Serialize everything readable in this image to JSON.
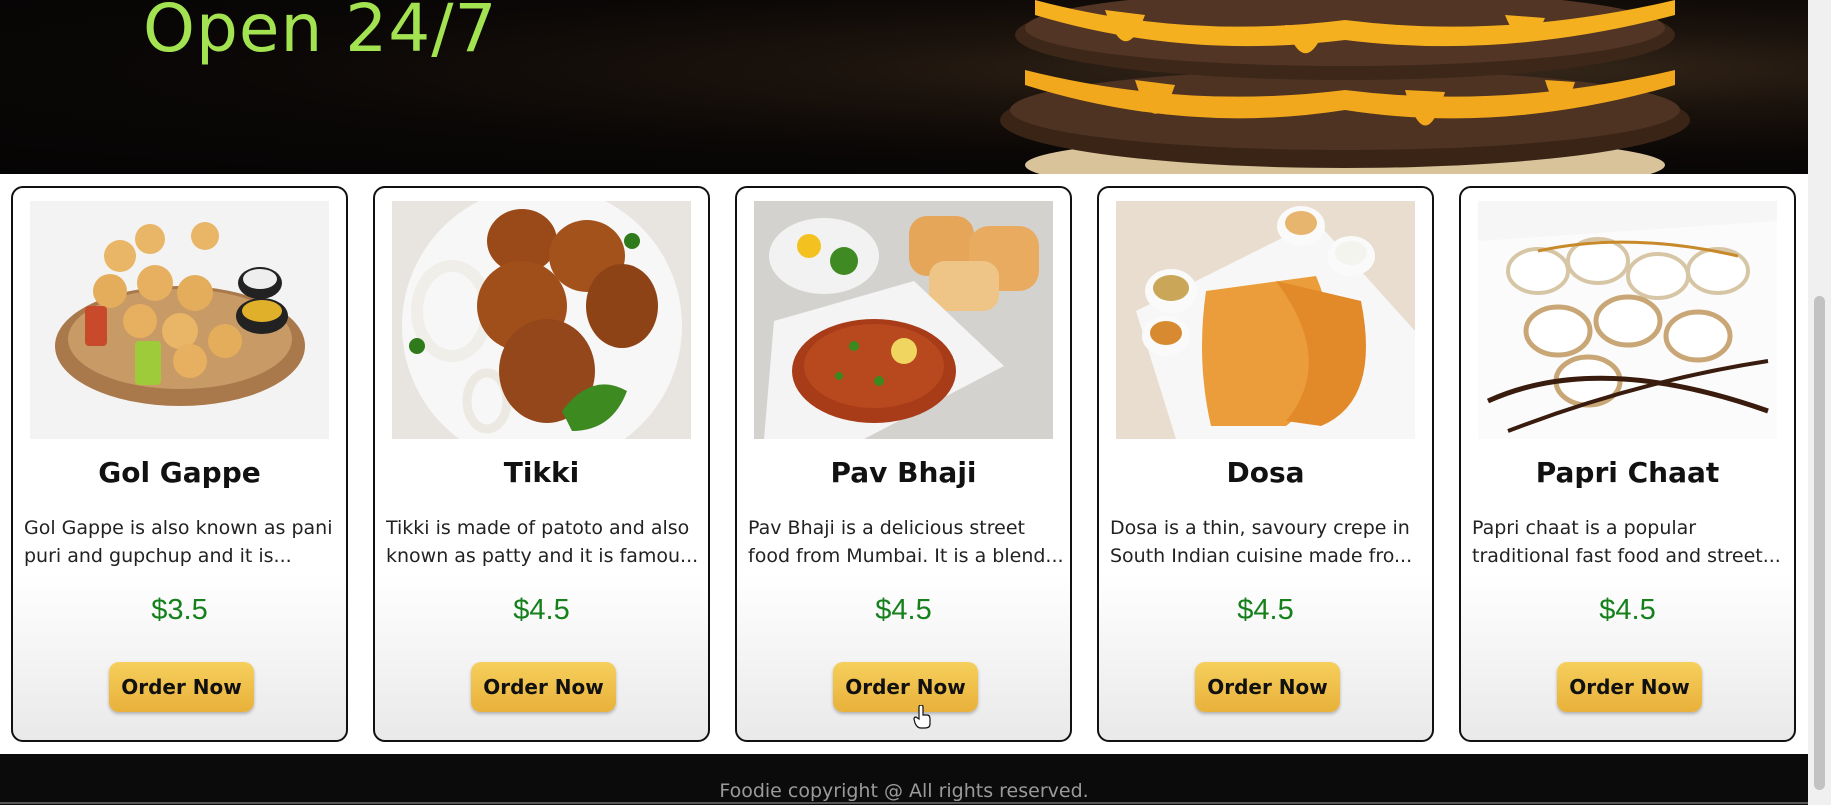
{
  "hero": {
    "title": "Open 24/7"
  },
  "cards": [
    {
      "name": "Gol Gappe",
      "description": "Gol Gappe is also known as pani puri and gupchup and it is...",
      "price": "$3.5",
      "button": "Order Now"
    },
    {
      "name": "Tikki",
      "description": "Tikki is made of patoto and also known as patty and it is famou...",
      "price": "$4.5",
      "button": "Order Now"
    },
    {
      "name": "Pav Bhaji",
      "description": "Pav Bhaji is a delicious street food from Mumbai. It is a blend...",
      "price": "$4.5",
      "button": "Order Now"
    },
    {
      "name": "Dosa",
      "description": "Dosa is a thin, savoury crepe in South Indian cuisine made fro...",
      "price": "$4.5",
      "button": "Order Now"
    },
    {
      "name": "Papri Chaat",
      "description": "Papri chaat is a popular traditional fast food and street...",
      "price": "$4.5",
      "button": "Order Now"
    }
  ],
  "footer": {
    "text": "Foodie copyright @ All rights reserved."
  },
  "colors": {
    "hero_title": "#a3e250",
    "price": "#15801c",
    "button": "#f0c24a"
  }
}
